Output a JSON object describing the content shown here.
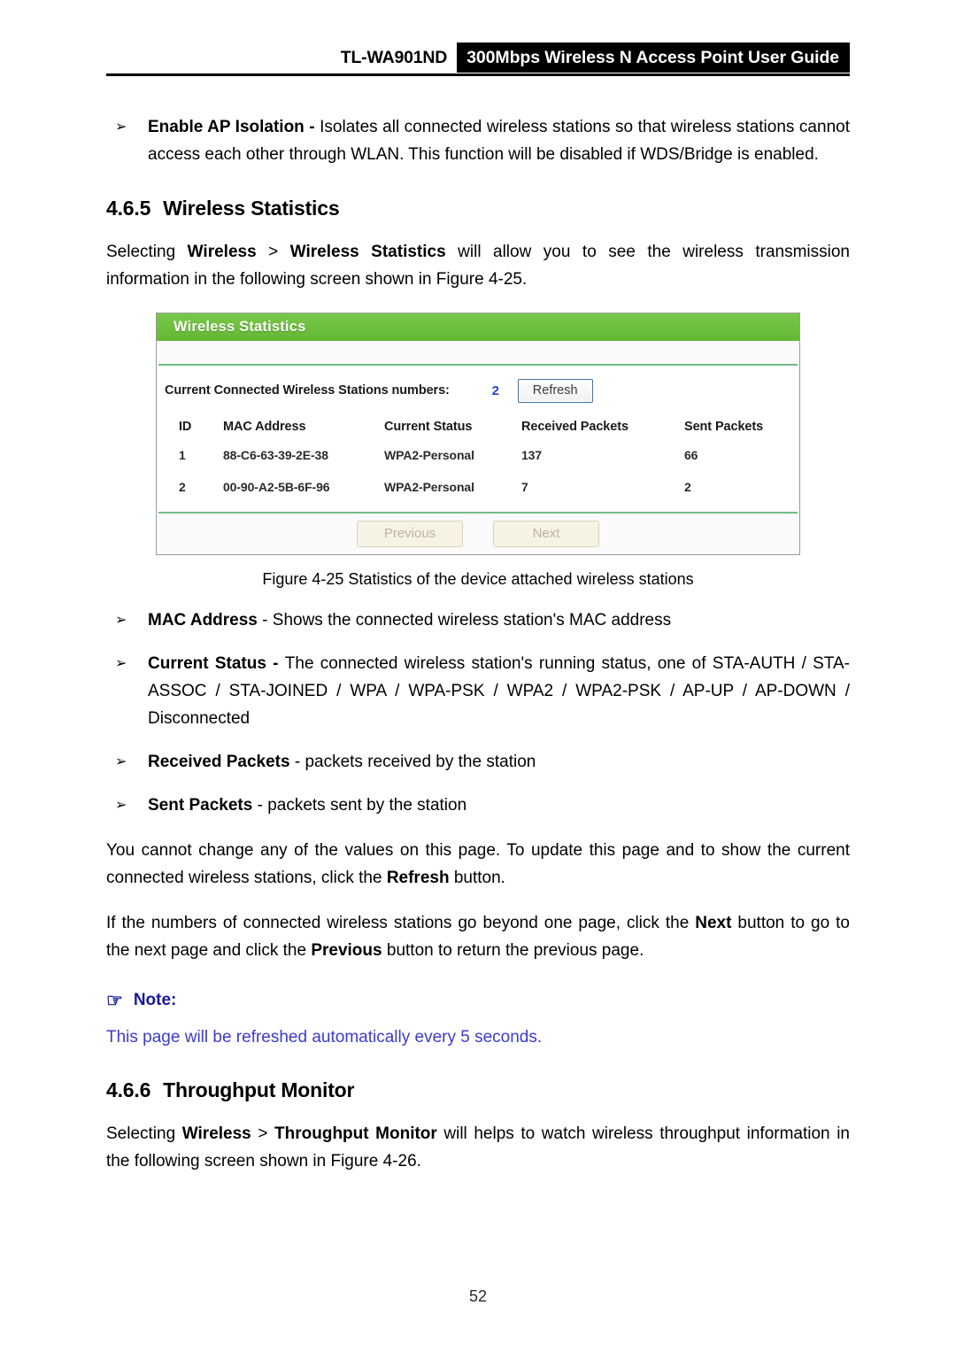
{
  "header": {
    "model": "TL-WA901ND",
    "title": "300Mbps Wireless N Access Point User Guide"
  },
  "bullets_top": [
    {
      "marker": "➢",
      "term": "Enable AP Isolation",
      "dash": " - ",
      "text": "Isolates all connected wireless stations so that wireless stations cannot access each other through WLAN. This function will be disabled if WDS/Bridge is enabled."
    }
  ],
  "section_465": {
    "number": "4.6.5",
    "title": "Wireless Statistics",
    "intro_pre": "Selecting ",
    "intro_bold1": "Wireless",
    "intro_gt": " > ",
    "intro_bold2": "Wireless Statistics",
    "intro_post": " will allow you to see the wireless transmission information in the following screen shown in Figure 4-25."
  },
  "ui_screenshot": {
    "panel_title": "Wireless Statistics",
    "count_label": "Current Connected Wireless Stations numbers:",
    "count_value": "2",
    "refresh_label": "Refresh",
    "columns": [
      "ID",
      "MAC Address",
      "Current Status",
      "Received Packets",
      "Sent Packets"
    ],
    "rows": [
      {
        "id": "1",
        "mac": "88-C6-63-39-2E-38",
        "status": "WPA2-Personal",
        "received": "137",
        "sent": "66"
      },
      {
        "id": "2",
        "mac": "00-90-A2-5B-6F-96",
        "status": "WPA2-Personal",
        "received": "7",
        "sent": "2"
      }
    ],
    "previous_label": "Previous",
    "next_label": "Next",
    "colors": {
      "header_green": "#6CBE3C",
      "separator_green": "#6CBE85",
      "count_blue": "#2A44C8",
      "disabled_button_bg": "#F6F2E4"
    }
  },
  "figure_caption": "Figure 4-25 Statistics of the device attached wireless stations",
  "bullets_desc": [
    {
      "marker": "➢",
      "term": "MAC Address",
      "dash": " - ",
      "text": "Shows the connected wireless station's MAC address"
    },
    {
      "marker": "➢",
      "term": "Current Status",
      "dash": " - ",
      "text": "The connected wireless station's running status, one of STA-AUTH / STA-ASSOC / STA-JOINED / WPA / WPA-PSK / WPA2 / WPA2-PSK / AP-UP / AP-DOWN / Disconnected"
    },
    {
      "marker": "➢",
      "term": "Received Packets",
      "dash": " - ",
      "text": "packets received by the station"
    },
    {
      "marker": "➢",
      "term": "Sent Packets",
      "dash": " - ",
      "text": "packets sent by the station"
    }
  ],
  "paragraphs": {
    "p1_a": "You cannot change any of the values on this page. To update this page and to show the current connected wireless stations, click the ",
    "p1_bold": "Refresh",
    "p1_b": " button.",
    "p2_a": "If the numbers of connected wireless stations go beyond one page, click the ",
    "p2_bold1": "Next",
    "p2_b": " button to go to the next page and click the ",
    "p2_bold2": "Previous",
    "p2_c": " button to return the previous page."
  },
  "note": {
    "icon": "☞",
    "label": "Note:",
    "text": "This page will be refreshed automatically every 5 seconds."
  },
  "section_466": {
    "number": "4.6.6",
    "title": "Throughput Monitor",
    "intro_pre": "Selecting ",
    "intro_bold1": "Wireless",
    "intro_gt": " > ",
    "intro_bold2": "Throughput Monitor",
    "intro_post": " will helps to watch wireless throughput information in the following screen shown in Figure 4-26."
  },
  "page_number": "52"
}
